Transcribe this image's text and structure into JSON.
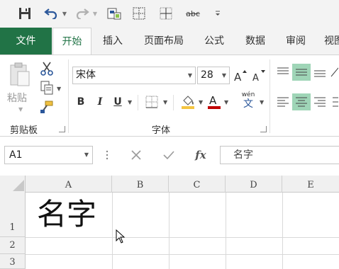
{
  "quick_access": {
    "icons": [
      "save-icon",
      "undo-icon",
      "redo-icon",
      "print-preview-icon",
      "borders-icon",
      "gridlines-icon",
      "spelling-icon",
      "customize-icon"
    ],
    "spelling_label": "abc"
  },
  "tabs": [
    {
      "label": "文件"
    },
    {
      "label": "开始"
    },
    {
      "label": "插入"
    },
    {
      "label": "页面布局"
    },
    {
      "label": "公式"
    },
    {
      "label": "数据"
    },
    {
      "label": "审阅"
    },
    {
      "label": "视图"
    }
  ],
  "ribbon": {
    "clipboard": {
      "paste_label": "粘贴",
      "group_label": "剪贴板"
    },
    "font": {
      "font_name": "宋体",
      "font_size": "28",
      "bold_label": "B",
      "italic_label": "I",
      "underline_label": "U",
      "phonetic_label": "wén",
      "phonetic_char": "文",
      "group_label": "字体"
    }
  },
  "formula_bar": {
    "name_box": "A1",
    "fx_label": "fx",
    "content": "名字"
  },
  "sheet": {
    "columns": [
      "A",
      "B",
      "C",
      "D",
      "E"
    ],
    "rows": [
      "1",
      "2",
      "3"
    ],
    "cell_a1": "名字"
  },
  "colors": {
    "accent": "#217346",
    "selected_align": "#9fd5b7",
    "ribbon_bg": "#f3f3f3"
  }
}
